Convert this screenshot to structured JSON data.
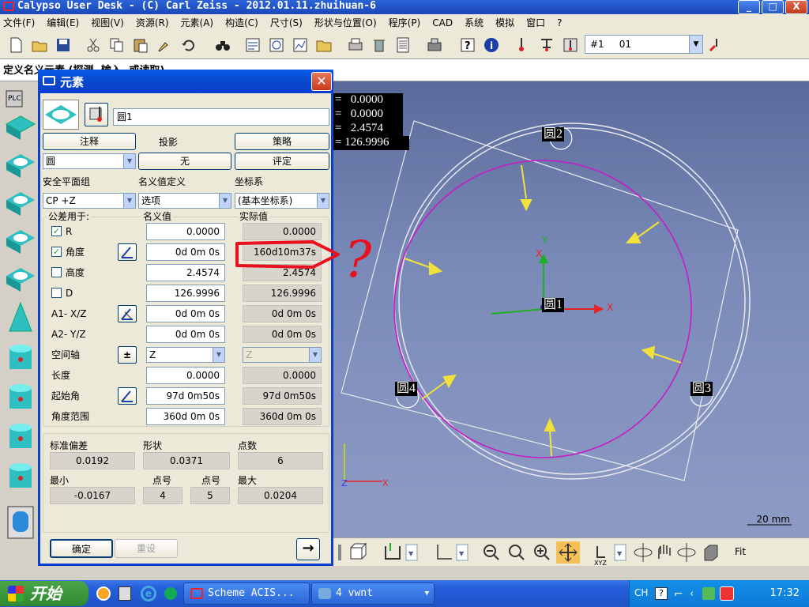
{
  "window": {
    "title": "Calypso User Desk - (C) Carl Zeiss - 2012.01.11.zhuihuan-6",
    "minimize": "_",
    "maximize": "□",
    "close": "X"
  },
  "menu": [
    "文件(F)",
    "编辑(E)",
    "视图(V)",
    "资源(R)",
    "元素(A)",
    "构造(C)",
    "尺寸(S)",
    "形状与位置(O)",
    "程序(P)",
    "CAD",
    "系统",
    "模拟",
    "窗口",
    "?"
  ],
  "toolbar": {
    "feature_select": "#1     01"
  },
  "status_line": "定义名义元素 (探测, 输入, 或读取)",
  "dialog": {
    "title": "元素",
    "element_name": "圆1",
    "btn_annotation": "注释",
    "label_projection": "投影",
    "btn_strategy": "策略",
    "element_type": "圆",
    "btn_projection_none": "无",
    "btn_evaluate": "评定",
    "label_safety_plane": "安全平面组",
    "label_nominal_def": "名义值定义",
    "label_coord_sys": "坐标系",
    "safety_plane_value": "CP +Z",
    "nominal_def_value": "选项",
    "coord_sys_value": "(基本坐标系)",
    "label_tolerance_for": "公差用于:",
    "label_nominal": "名义值",
    "label_actual": "实际值",
    "rows": [
      {
        "label": "R",
        "checkbox": true,
        "checked": true,
        "nominal": "0.0000",
        "actual": "0.0000"
      },
      {
        "label": "角度",
        "checkbox": true,
        "checked": true,
        "nominal": "0d 0m 0s",
        "actual": "160d10m37s"
      },
      {
        "label": "高度",
        "checkbox": true,
        "checked": false,
        "nominal": "2.4574",
        "actual": "2.4574"
      },
      {
        "label": "D",
        "checkbox": true,
        "checked": false,
        "nominal": "126.9996",
        "actual": "126.9996"
      },
      {
        "label": "A1- X/Z",
        "checkbox": false,
        "checked": false,
        "nominal": "0d 0m 0s",
        "actual": "0d 0m 0s"
      },
      {
        "label": "A2- Y/Z",
        "checkbox": false,
        "checked": false,
        "nominal": "0d 0m 0s",
        "actual": "0d 0m 0s"
      },
      {
        "label": "空间轴",
        "checkbox": false,
        "checked": false,
        "nominal": "Z",
        "actual": "Z"
      },
      {
        "label": "长度",
        "checkbox": false,
        "checked": false,
        "nominal": "0.0000",
        "actual": "0.0000"
      },
      {
        "label": "起始角",
        "checkbox": false,
        "checked": false,
        "nominal": "97d 0m50s",
        "actual": "97d 0m50s"
      },
      {
        "label": "角度范围",
        "checkbox": false,
        "checked": false,
        "nominal": "360d 0m 0s",
        "actual": "360d 0m 0s"
      }
    ],
    "plus_minus": "±",
    "label_std_dev": "标准偏差",
    "label_form": "形状",
    "label_points": "点数",
    "std_dev": "0.0192",
    "form": "0.0371",
    "points": "6",
    "label_min": "最小",
    "label_point_no_1": "点号",
    "label_point_no_2": "点号",
    "label_max": "最大",
    "min": "-0.0167",
    "min_point": "4",
    "max_point": "5",
    "max": "0.0204",
    "btn_ok": "确定",
    "btn_reset": "重设",
    "btn_next": "→"
  },
  "canvas": {
    "readout": [
      "=   0.0000",
      "=   0.0000",
      "=   2.4574",
      "= 126.9996"
    ],
    "circles": [
      "圆2",
      "圆1",
      "圆4",
      "圆3"
    ],
    "axis_x": "X",
    "axis_y": "Y",
    "axis_z": "Z",
    "scale": "20 mm",
    "annotation_mark": "?"
  },
  "viewbar": {
    "fit": "Fit"
  },
  "taskbar": {
    "start": "开始",
    "items": [
      "Scheme ACIS...",
      "4 vwnt"
    ],
    "ime": "CH",
    "clock": "17:32"
  },
  "colors": {
    "circle_magenta": "#c81bc8",
    "arrow_yellow": "#f0e23a",
    "annotation_red": "#e8101c",
    "title_blue": "#0a3fd0"
  }
}
